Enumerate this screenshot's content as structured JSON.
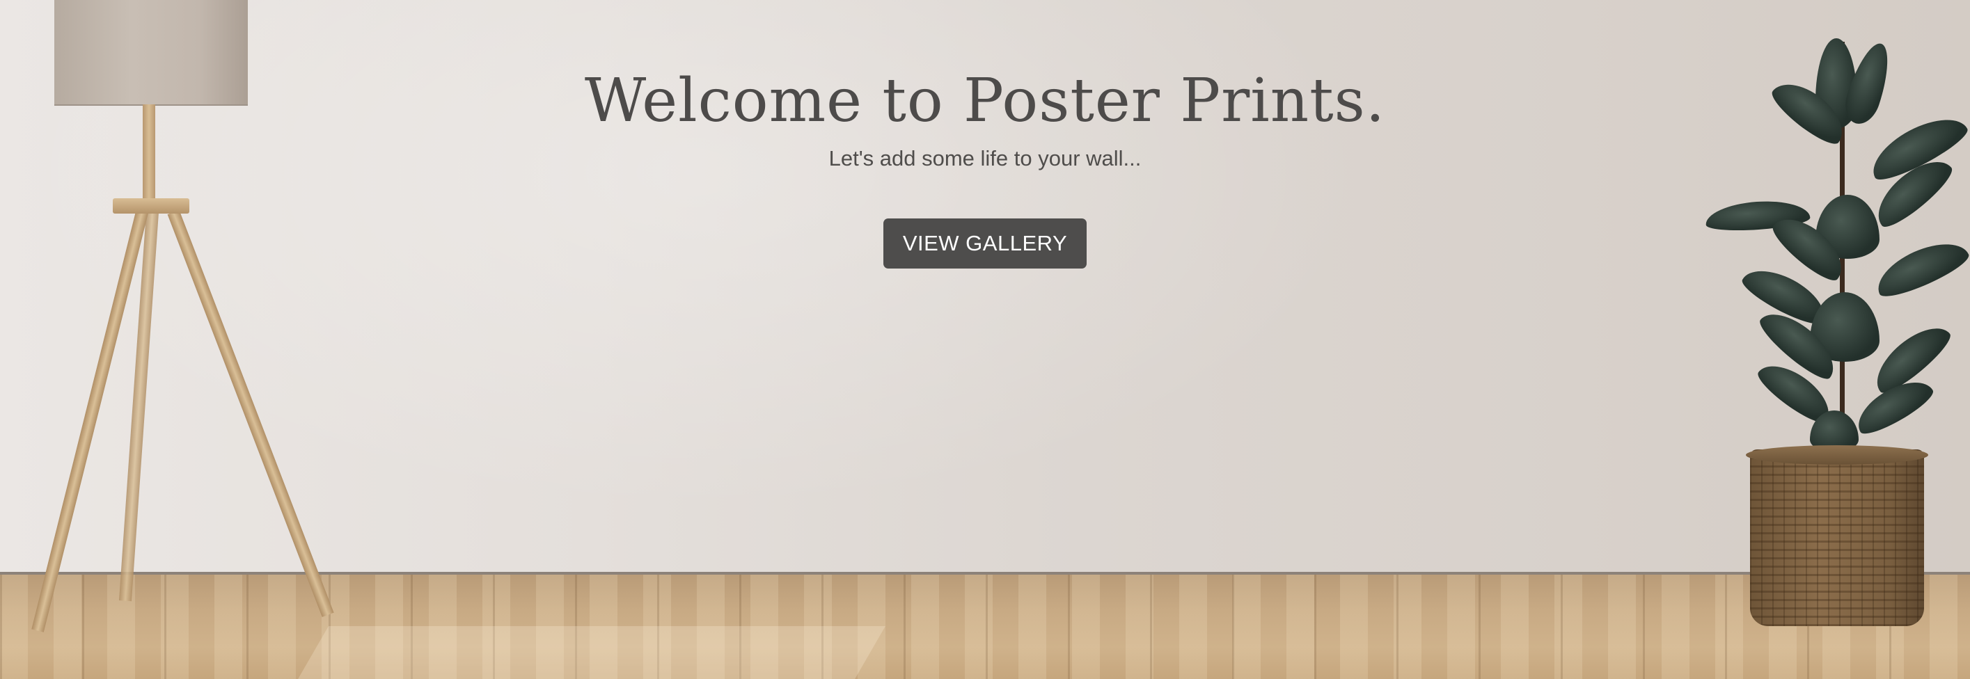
{
  "hero": {
    "title": "Welcome to Poster Prints.",
    "subtitle": "Let's add some life to your wall...",
    "cta_label": "VIEW GALLERY"
  },
  "colors": {
    "text": "#4d4b4a",
    "button_bg": "#4e4d4c",
    "button_text": "#ffffff",
    "wall": "#e3deda",
    "floor": "#c8aa84"
  }
}
